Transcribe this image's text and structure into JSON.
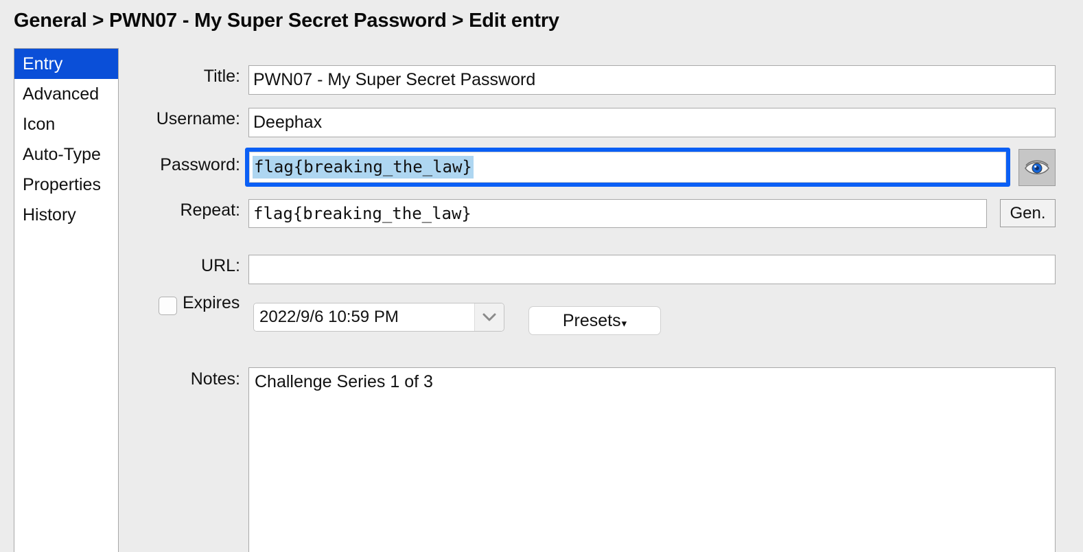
{
  "window": {
    "breadcrumb": "General > PWN07 - My Super Secret Password > Edit entry"
  },
  "sidebar": {
    "items": [
      {
        "label": "Entry",
        "selected": true
      },
      {
        "label": "Advanced",
        "selected": false
      },
      {
        "label": "Icon",
        "selected": false
      },
      {
        "label": "Auto-Type",
        "selected": false
      },
      {
        "label": "Properties",
        "selected": false
      },
      {
        "label": "History",
        "selected": false
      }
    ]
  },
  "form": {
    "title": {
      "label": "Title:",
      "value": "PWN07 - My Super Secret Password"
    },
    "username": {
      "label": "Username:",
      "value": "Deephax"
    },
    "password": {
      "label": "Password:",
      "value": "flag{breaking_the_law}",
      "selected": true,
      "focused": true
    },
    "repeat": {
      "label": "Repeat:",
      "value": "flag{breaking_the_law}"
    },
    "url": {
      "label": "URL:",
      "value": ""
    },
    "expires": {
      "label": "Expires",
      "checked": false
    },
    "expiry_date": {
      "value": "2022/9/6 10:59 PM"
    },
    "presets": {
      "label": "Presets",
      "caret": "▾"
    },
    "notes": {
      "label": "Notes:",
      "value": "Challenge Series 1 of 3"
    }
  },
  "buttons": {
    "reveal_password": {
      "icon": "eye-icon"
    },
    "generate_password": {
      "label": "Gen."
    }
  },
  "colors": {
    "background": "#ececec",
    "accent_selected": "#0a4fd8",
    "focus_ring": "#0a5ff5",
    "text_selection": "#aed6f1"
  }
}
